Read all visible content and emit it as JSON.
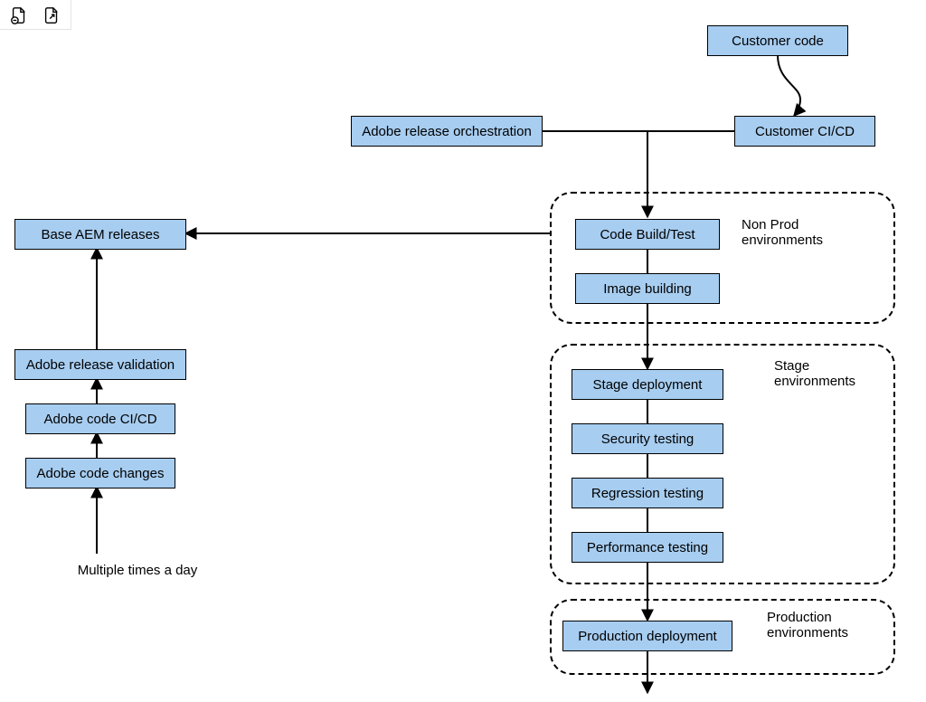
{
  "toolbar": {
    "icons": [
      "remove-page-icon",
      "expand-page-icon"
    ]
  },
  "nodes": {
    "customer_code": "Customer code",
    "adobe_release_orchestration": "Adobe release orchestration",
    "customer_cicd": "Customer CI/CD",
    "code_build_test": "Code Build/Test",
    "image_building": "Image building",
    "stage_deployment": "Stage deployment",
    "security_testing": "Security testing",
    "regression_testing": "Regression testing",
    "performance_testing": "Performance testing",
    "production_deployment": "Production deployment",
    "base_aem_releases": "Base AEM releases",
    "adobe_release_validation": "Adobe release validation",
    "adobe_code_cicd": "Adobe code CI/CD",
    "adobe_code_changes": "Adobe code changes"
  },
  "groups": {
    "nonprod": "Non Prod environments",
    "stage": "Stage environments",
    "prod": "Production environments"
  },
  "labels": {
    "multiple_times": "Multiple times a day"
  },
  "colors": {
    "node_fill": "#a7cdf0"
  }
}
